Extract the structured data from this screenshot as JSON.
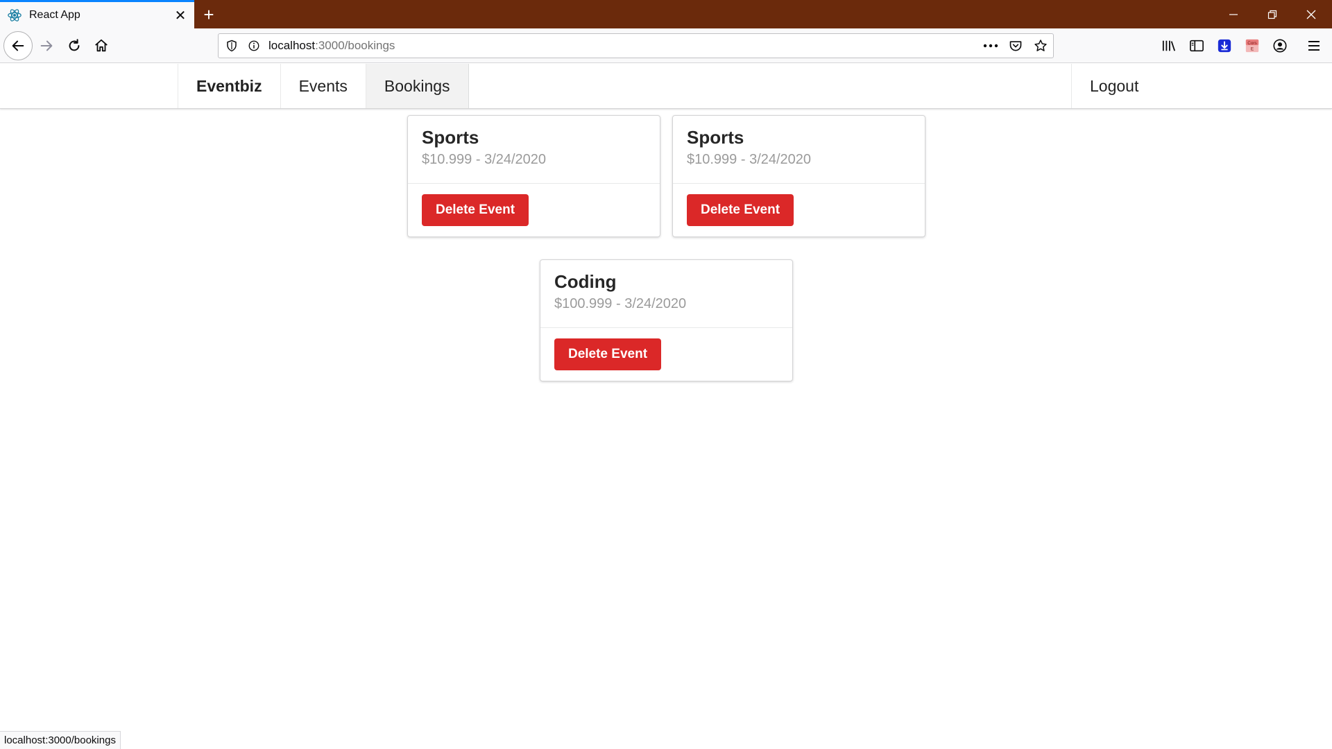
{
  "browser": {
    "tab_title": "React App",
    "url_host": "localhost",
    "url_path": ":3000/bookings",
    "status_text": "localhost:3000/bookings",
    "accent_color": "#0a84ff",
    "titlebar_color": "#6b2a0c"
  },
  "app": {
    "brand": "Eventbiz",
    "nav": [
      {
        "label": "Events"
      },
      {
        "label": "Bookings",
        "active": true
      }
    ],
    "logout_label": "Logout",
    "bookings": [
      {
        "title": "Sports",
        "meta": "$10.999 - 3/24/2020",
        "button_label": "Delete Event"
      },
      {
        "title": "Sports",
        "meta": "$10.999 - 3/24/2020",
        "button_label": "Delete Event"
      },
      {
        "title": "Coding",
        "meta": "$100.999 - 3/24/2020",
        "button_label": "Delete Event"
      }
    ],
    "button_color": "#db2828"
  }
}
